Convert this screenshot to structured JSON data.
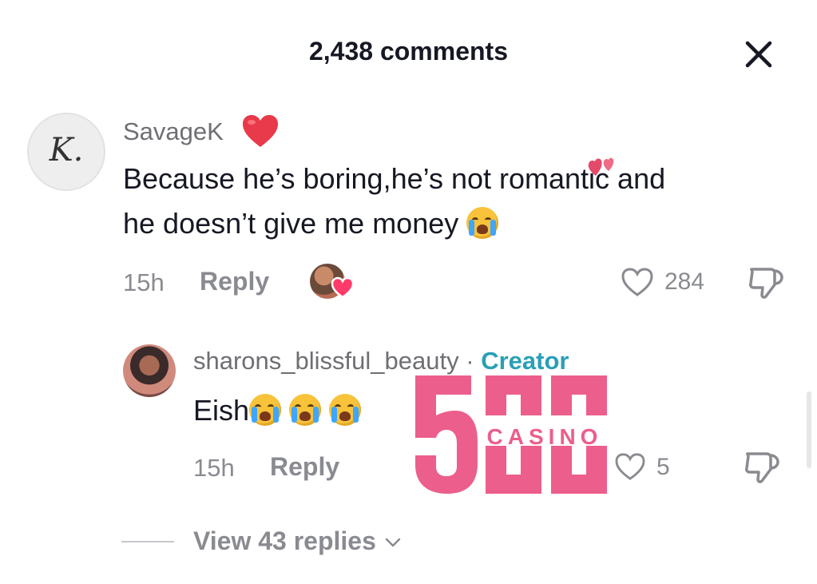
{
  "header": {
    "title": "2,438 comments",
    "close_icon": "close-icon"
  },
  "comments": [
    {
      "avatar_letter": "K.",
      "username": "SavageK",
      "username_badge": "red-heart-icon",
      "text_line1": "Because he’s boring,he’s not romantic and",
      "text_line2": "he doesn’t give me money",
      "text_emoji": "loudly-crying-face-icon",
      "time": "15h",
      "reply_label": "Reply",
      "liked_by_creator": "creator-heart-avatar",
      "likes": "284"
    },
    {
      "username": "sharons_blissful_beauty",
      "separator": "·",
      "role": "Creator",
      "text": "Eish",
      "text_emojis": [
        "loudly-crying-face-icon",
        "loudly-crying-face-icon",
        "loudly-crying-face-icon"
      ],
      "time": "15h",
      "reply_label": "Reply",
      "likes": "5"
    }
  ],
  "view_replies": {
    "label": "View 43 replies"
  },
  "watermark": {
    "number": "500",
    "word": "CASINO",
    "color": "#ec5e8b"
  },
  "colors": {
    "text": "#161823",
    "muted": "#8a8b91",
    "creator": "#2a9fb6",
    "heart": "#e83a4a"
  }
}
